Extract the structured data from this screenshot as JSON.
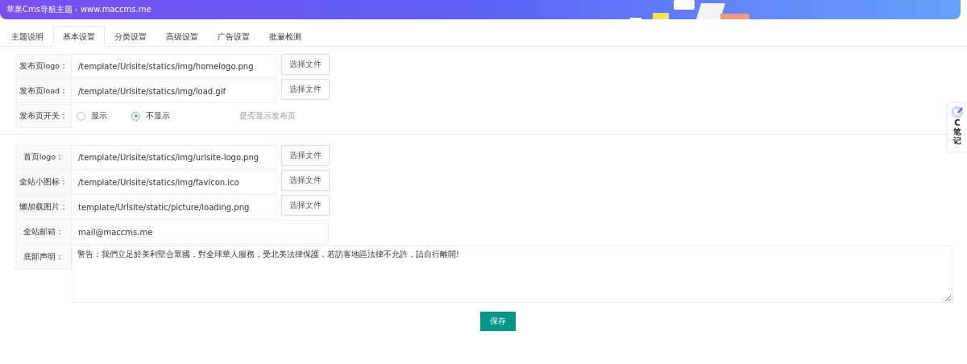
{
  "header": {
    "title": "苹果Cms导航主题 - www.maccms.me"
  },
  "tabs": [
    {
      "label": "主题说明",
      "selected": false
    },
    {
      "label": "基本设置",
      "selected": true
    },
    {
      "label": "分类设置",
      "selected": false
    },
    {
      "label": "高级设置",
      "selected": false
    },
    {
      "label": "广告设置",
      "selected": false
    },
    {
      "label": "批量检测",
      "selected": false
    }
  ],
  "groups": [
    {
      "fields": [
        {
          "kind": "file",
          "label": "发布页logo：",
          "value": "/template/Urlsite/statics/img/homelogo.png",
          "button": "选择文件"
        },
        {
          "kind": "file",
          "label": "发布页load：",
          "value": "/template/Urlsite/statics/img/load.gif",
          "button": "选择文件"
        },
        {
          "kind": "radio",
          "label": "发布页开关：",
          "options": [
            {
              "label": "显示",
              "selected": false
            },
            {
              "label": "不显示",
              "selected": true
            }
          ],
          "hint": "是否显示发布页"
        }
      ]
    },
    {
      "fields": [
        {
          "kind": "file",
          "label": "首页logo：",
          "value": "/template/Urlsite/statics/img/urlsite-logo.png",
          "button": "选择文件"
        },
        {
          "kind": "file",
          "label": "全站小图标：",
          "value": "/template/Urlsite/statics/img/favicon.ico",
          "button": "选择文件"
        },
        {
          "kind": "file",
          "label": "懒加载图片：",
          "value": "template/Urlsite/static/picture/loading.png",
          "button": "选择文件"
        },
        {
          "kind": "text",
          "label": "全站邮箱：",
          "value": "mail@maccms.me"
        },
        {
          "kind": "textarea",
          "label": "底部声明：",
          "value": "警告：我們立足於美利堅合眾國，對全球華人服務，受北美法律保護，若訪客地區法律不允許，請自行離開!"
        }
      ]
    }
  ],
  "save_button": "保存",
  "side_widget": {
    "label": "C笔记"
  }
}
